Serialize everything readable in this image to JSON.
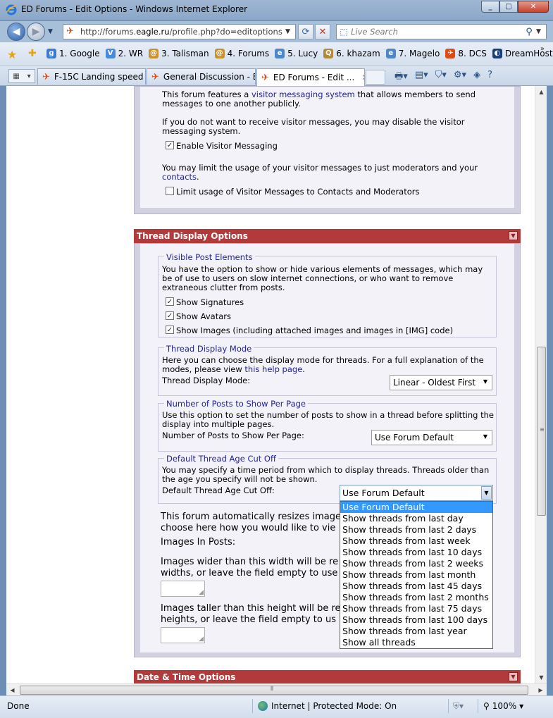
{
  "window": {
    "title": "ED Forums - Edit Options - Windows Internet Explorer",
    "buttons": [
      "_",
      "□",
      "✕"
    ]
  },
  "nav": {
    "url_prefix": "http://forums.",
    "url_domain": "eagle.ru",
    "url_suffix": "/profile.php?do=editoptions",
    "search_placeholder": "Live Search"
  },
  "favorites": [
    {
      "label": "1. Google",
      "icon": "google-icon",
      "color": "#3a7bd5",
      "glyph": "g"
    },
    {
      "label": "2. WR",
      "icon": "wr-icon",
      "color": "#4a8ad6",
      "glyph": "V"
    },
    {
      "label": "3. Talisman",
      "icon": "talisman-icon",
      "color": "#c9922e",
      "glyph": "@"
    },
    {
      "label": "4. Forums",
      "icon": "forums-icon",
      "color": "#c9922e",
      "glyph": "@"
    },
    {
      "label": "5. Lucy",
      "icon": "ie-page-icon",
      "color": "#4f86c6",
      "glyph": "e"
    },
    {
      "label": "6. khazam",
      "icon": "khazam-icon",
      "color": "#b08a3c",
      "glyph": "Q"
    },
    {
      "label": "7. Magelo",
      "icon": "ie-page-icon",
      "color": "#4f86c6",
      "glyph": "e"
    },
    {
      "label": "8. DCS",
      "icon": "dcs-icon",
      "color": "#e04a14",
      "glyph": "✈"
    },
    {
      "label": "DreamHost",
      "icon": "dreamhost-icon",
      "color": "#1b3d7a",
      "glyph": "◐"
    }
  ],
  "tabs": [
    {
      "label": "F-15C Landing speed ..."
    },
    {
      "label": "General Discussion - E..."
    },
    {
      "label": "ED Forums - Edit ..."
    }
  ],
  "page": {
    "visitor": {
      "intro_1": "This forum features a ",
      "intro_link": "visitor messaging system",
      "intro_2": " that allows members to send",
      "intro_3": "messages to one another publicly.",
      "disable_1": "If you do not want to receive visitor messages, you may disable the visitor",
      "disable_2": "messaging system.",
      "enable_label": "Enable Visitor Messaging",
      "enable_checked": true,
      "limit_1": "You may limit the usage of your visitor messages to just moderators and your",
      "limit_link": "contacts",
      "limit_end": ".",
      "limit_label": "Limit usage of Visitor Messages to Contacts and Moderators",
      "limit_checked": false
    },
    "thread_display": {
      "header": "Thread Display Options",
      "visible": {
        "legend": "Visible Post Elements",
        "desc_1": "You have the option to show or hide various elements of messages, which may",
        "desc_2": "be of use to users on slow internet connections, or who want to remove",
        "desc_3": "extraneous clutter from posts.",
        "signatures": "Show Signatures",
        "avatars": "Show Avatars",
        "images": "Show Images (including attached images and images in [IMG] code)"
      },
      "mode": {
        "legend": "Thread Display Mode",
        "desc_1": "Here you can choose the display mode for threads. For a full explanation of the",
        "desc_2a": "modes, please view ",
        "desc_link": "this help page",
        "desc_2b": ".",
        "label": "Thread Display Mode:",
        "value": "Linear - Oldest First"
      },
      "posts": {
        "legend": "Number of Posts to Show Per Page",
        "desc_1": "Use this option to set the number of posts to show in a thread before splitting the",
        "desc_2": "display into multiple pages.",
        "label": "Number of Posts to Show Per Page:",
        "value": "Use Forum Default"
      },
      "age": {
        "legend": "Default Thread Age Cut Off",
        "desc_1": "You may specify a time period from which to display threads. Threads older than",
        "desc_2": "the age you specify will not be shown.",
        "label": "Default Thread Age Cut Off:",
        "value": "Use Forum Default",
        "options": [
          "Use Forum Default",
          "Show threads from last day",
          "Show threads from last 2 days",
          "Show threads from last week",
          "Show threads from last 10 days",
          "Show threads from last 2 weeks",
          "Show threads from last month",
          "Show threads from last 45 days",
          "Show threads from last 2 months",
          "Show threads from last 75 days",
          "Show threads from last 100 days",
          "Show threads from last year",
          "Show all threads"
        ]
      },
      "images": {
        "resize_1": "This forum automatically resizes image",
        "resize_2": "choose here how you would like to vie",
        "label": "Images In Posts:",
        "width_1": "Images wider than this width will be re",
        "width_2": "widths, or leave the field empty to use",
        "height_1": "Images taller than this height will be re",
        "height_2": "heights, or leave the field empty to us"
      }
    },
    "datetime": {
      "header": "Date & Time Options"
    }
  },
  "status": {
    "text": "Done",
    "zone": "Internet | Protected Mode: On",
    "zoom": "100%"
  }
}
